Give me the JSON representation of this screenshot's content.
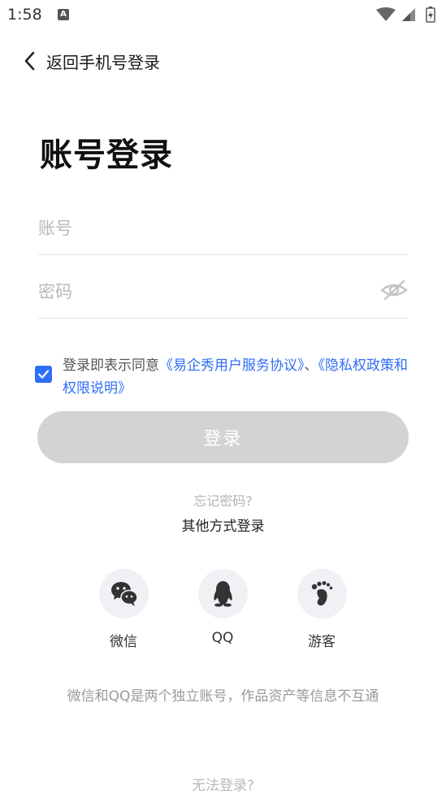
{
  "status_bar": {
    "time": "1:58",
    "notification_letter": "A"
  },
  "header": {
    "back_label": "返回手机号登录"
  },
  "page": {
    "title": "账号登录"
  },
  "form": {
    "account_placeholder": "账号",
    "account_value": "",
    "password_placeholder": "密码",
    "password_value": ""
  },
  "agreement": {
    "checked": true,
    "prefix": "登录即表示同意",
    "service_link": "《易企秀用户服务协议》",
    "separator": "、",
    "privacy_link": "《隐私权政策和权限说明》"
  },
  "login_button": "登录",
  "forgot_password": "忘记密码?",
  "other_methods": {
    "title": "其他方式登录",
    "items": [
      {
        "label": "微信",
        "icon": "wechat-icon"
      },
      {
        "label": "QQ",
        "icon": "qq-icon"
      },
      {
        "label": "游客",
        "icon": "footprint-icon"
      }
    ]
  },
  "notice": "微信和QQ是两个独立账号，作品资产等信息不互通",
  "cannot_login": "无法登录?",
  "colors": {
    "accent": "#2f6ef6",
    "button_disabled": "#d3d3d3",
    "icon_gray": "#333333"
  }
}
